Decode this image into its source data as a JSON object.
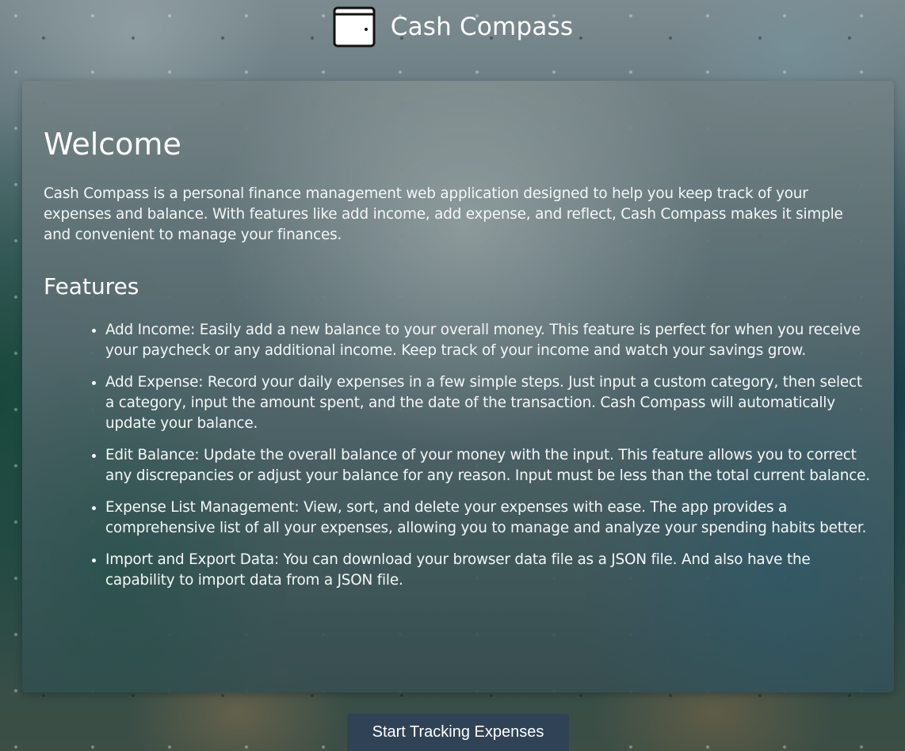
{
  "header": {
    "title": "Cash Compass",
    "icon": "wallet-icon"
  },
  "welcome": {
    "title": "Welcome",
    "intro": "Cash Compass is a personal finance management web application designed to help you keep track of your expenses and balance. With features like add income, add expense, and reflect, Cash Compass makes it simple and convenient to manage your finances."
  },
  "features": {
    "title": "Features",
    "items": [
      "Add Income: Easily add a new balance to your overall money. This feature is perfect for when you receive your paycheck or any additional income. Keep track of your income and watch your savings grow.",
      "Add Expense: Record your daily expenses in a few simple steps. Just input a custom category, then select a category, input the amount spent, and the date of the transaction. Cash Compass will automatically update your balance.",
      "Edit Balance: Update the overall balance of your money with the input. This feature allows you to correct any discrepancies or adjust your balance for any reason. Input must be less than the total current balance.",
      "Expense List Management: View, sort, and delete your expenses with ease. The app provides a comprehensive list of all your expenses, allowing you to manage and analyze your spending habits better.",
      "Import and Export Data: You can download your browser data file as a JSON file. And also have the capability to import data from a JSON file."
    ]
  },
  "cta": {
    "label": "Start Tracking Expenses"
  },
  "colors": {
    "button_background": "#304256",
    "text": "#ffffff"
  }
}
